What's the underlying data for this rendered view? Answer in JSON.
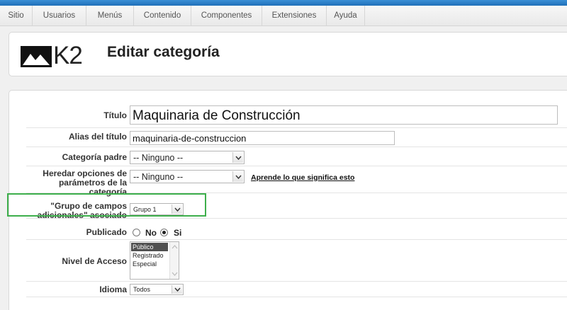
{
  "menu": {
    "items": [
      "Sitio",
      "Usuarios",
      "Menús",
      "Contenido",
      "Componentes",
      "Extensiones",
      "Ayuda"
    ]
  },
  "header": {
    "logo_text": "K2",
    "title": "Editar categoría"
  },
  "form": {
    "title_label": "Título",
    "title_value": "Maquinaria de Construcción",
    "alias_label": "Alias del título",
    "alias_value": "maquinaria-de-construccion",
    "parent_label": "Categoría padre",
    "parent_value": "-- Ninguno --",
    "inherit_label": "Heredar opciones de parámetros de la categoría",
    "inherit_value": "-- Ninguno --",
    "inherit_link": "Aprende lo que significa esto",
    "extra_fields_label": "\"Grupo de campos adicionales\" asociado",
    "extra_fields_value": "Grupo 1",
    "published_label": "Publicado",
    "published_no": "No",
    "published_yes": "Si",
    "published_selected": "Si",
    "access_label": "Nivel de Acceso",
    "access_options": [
      "Público",
      "Registrado",
      "Especial"
    ],
    "access_selected": "Público",
    "language_label": "Idioma",
    "language_value": "Todos"
  },
  "colors": {
    "accent_bar": "#2a7fc8",
    "highlight_box": "#3dae4b"
  }
}
